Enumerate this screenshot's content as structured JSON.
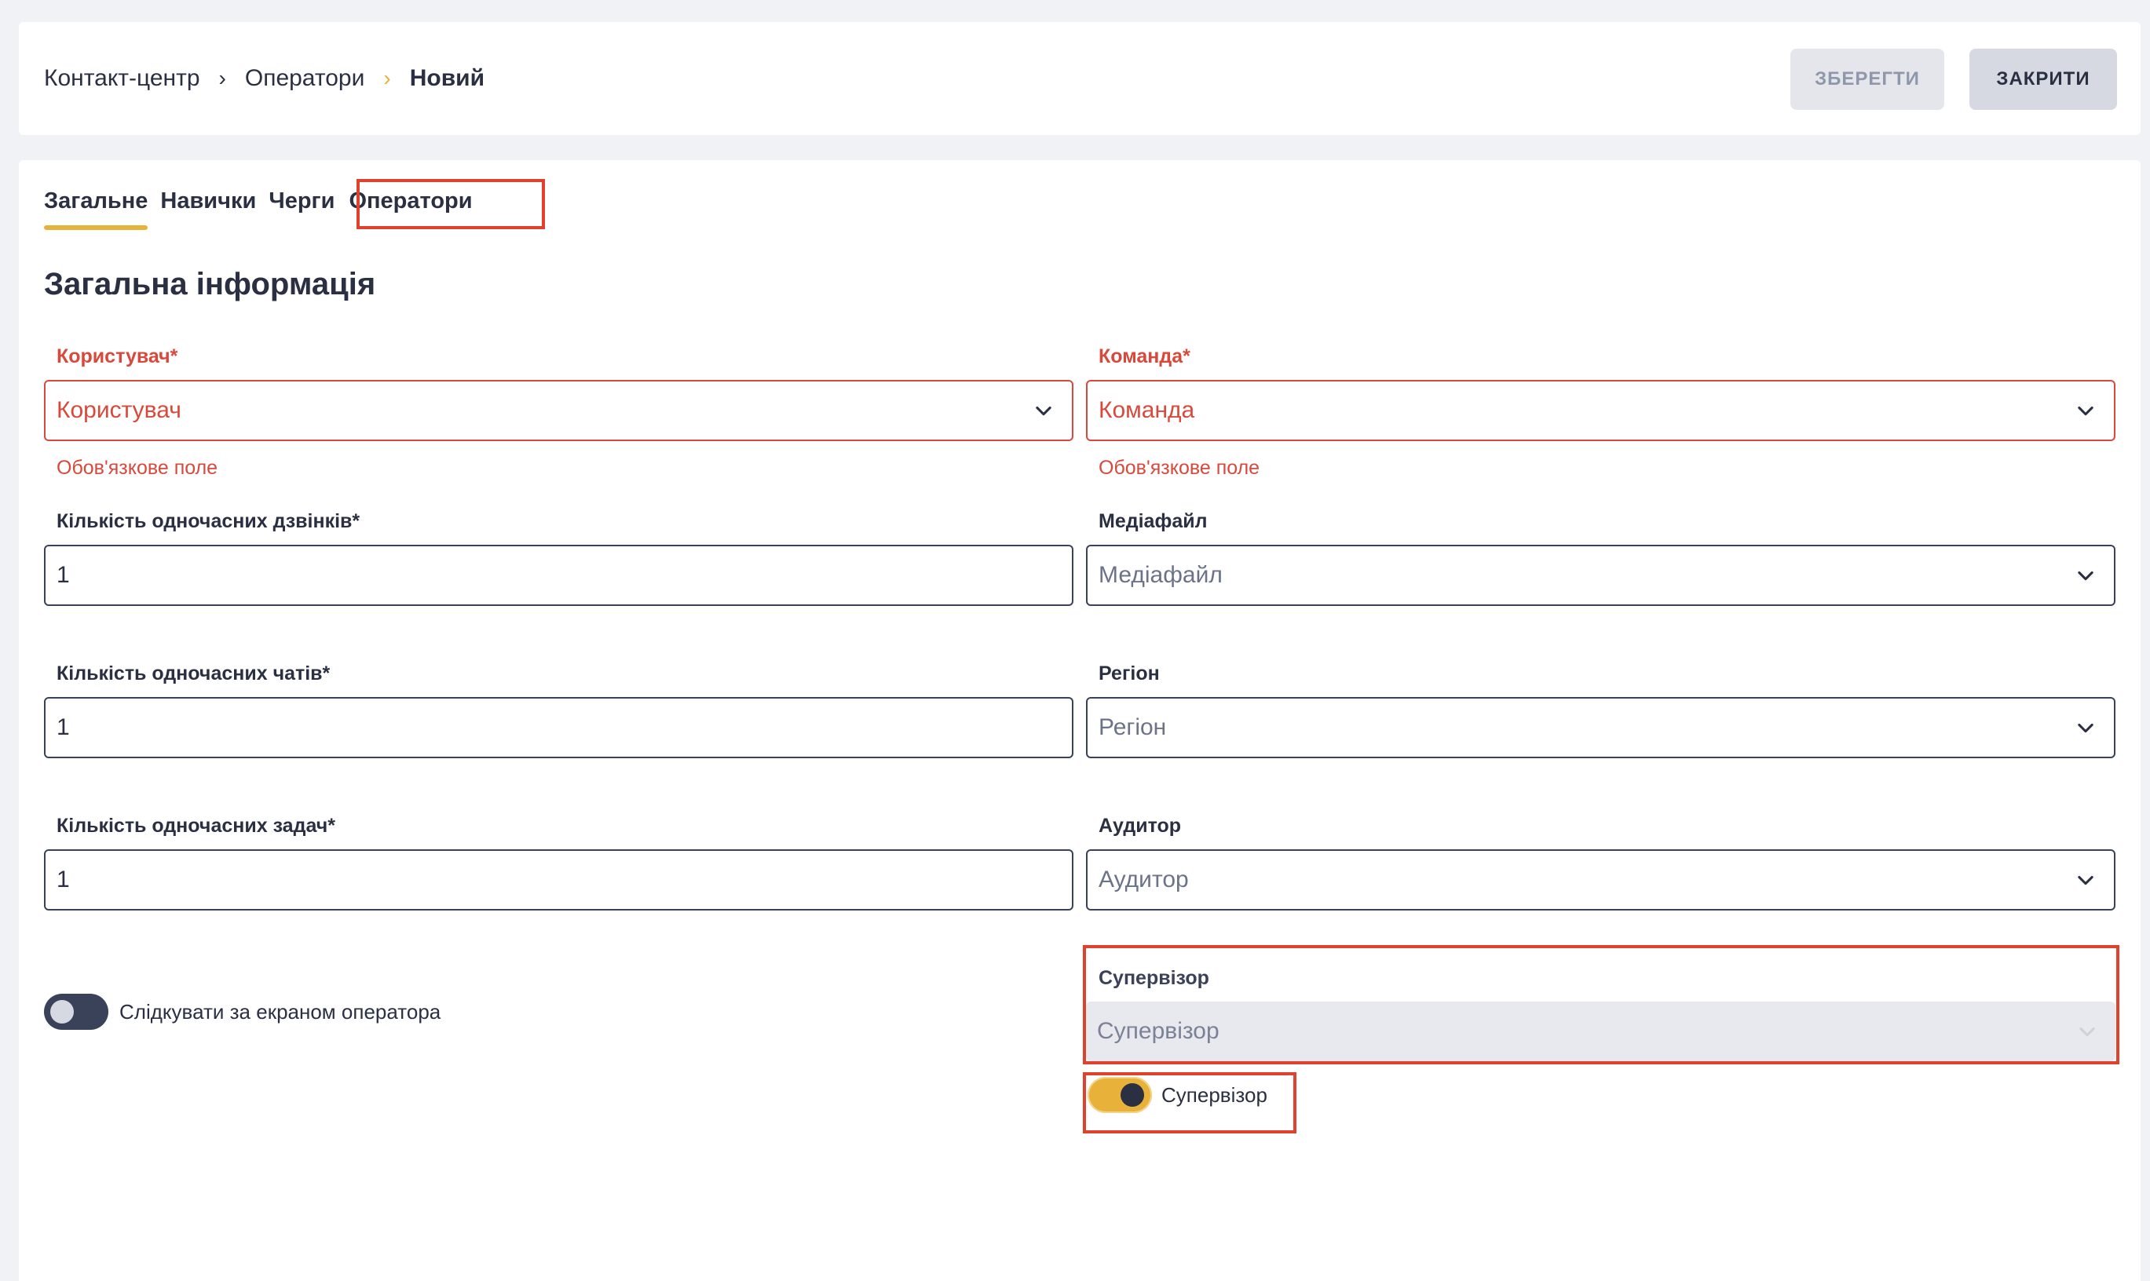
{
  "breadcrumb": {
    "items": [
      "Контакт-центр",
      "Оператори"
    ],
    "current": "Новий"
  },
  "toolbar": {
    "save_label": "ЗБЕРЕГТИ",
    "close_label": "ЗАКРИТИ"
  },
  "tabs": [
    {
      "label": "Загальне",
      "active": true
    },
    {
      "label": "Навички"
    },
    {
      "label": "Черги"
    },
    {
      "label": "Оператори"
    }
  ],
  "section_title": "Загальна інформація",
  "form": {
    "user": {
      "label": "Користувач*",
      "placeholder": "Користувач",
      "error": "Обов'язкове поле"
    },
    "team": {
      "label": "Команда*",
      "placeholder": "Команда",
      "error": "Обов'язкове поле"
    },
    "simultaneous_calls": {
      "label": "Кількість одночасних дзвінків*",
      "value": "1"
    },
    "media_file": {
      "label": "Медіафайл",
      "placeholder": "Медіафайл"
    },
    "simultaneous_chats": {
      "label": "Кількість одночасних чатів*",
      "value": "1"
    },
    "region": {
      "label": "Регіон",
      "placeholder": "Регіон"
    },
    "simultaneous_tasks": {
      "label": "Кількість одночасних задач*",
      "value": "1"
    },
    "auditor": {
      "label": "Аудитор",
      "placeholder": "Аудитор"
    },
    "supervisor_select": {
      "label": "Супервізор",
      "placeholder": "Супервізор"
    },
    "screen_tracking": {
      "label": "Слідкувати за екраном оператора",
      "on": false
    },
    "supervisor_toggle": {
      "label": "Супервізор",
      "on": true
    }
  },
  "colors": {
    "accent": "#e8b23a",
    "error": "#d9493b",
    "highlight": "#e0412c",
    "text": "#2a3042"
  }
}
